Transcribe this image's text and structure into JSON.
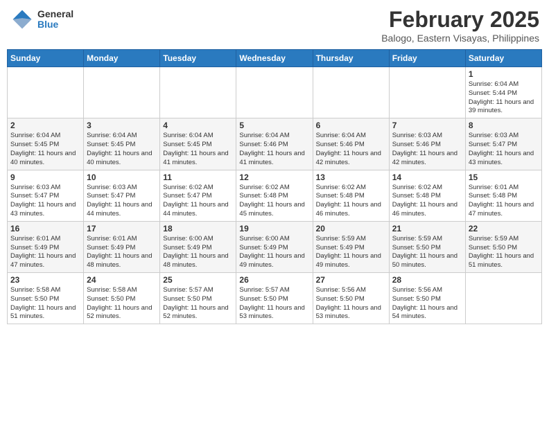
{
  "header": {
    "logo": {
      "line1": "General",
      "line2": "Blue"
    },
    "title": "February 2025",
    "location": "Balogo, Eastern Visayas, Philippines"
  },
  "weekdays": [
    "Sunday",
    "Monday",
    "Tuesday",
    "Wednesday",
    "Thursday",
    "Friday",
    "Saturday"
  ],
  "weeks": [
    [
      {
        "day": null,
        "info": null
      },
      {
        "day": null,
        "info": null
      },
      {
        "day": null,
        "info": null
      },
      {
        "day": null,
        "info": null
      },
      {
        "day": null,
        "info": null
      },
      {
        "day": null,
        "info": null
      },
      {
        "day": "1",
        "info": "Sunrise: 6:04 AM\nSunset: 5:44 PM\nDaylight: 11 hours and 39 minutes."
      }
    ],
    [
      {
        "day": "2",
        "info": "Sunrise: 6:04 AM\nSunset: 5:45 PM\nDaylight: 11 hours and 40 minutes."
      },
      {
        "day": "3",
        "info": "Sunrise: 6:04 AM\nSunset: 5:45 PM\nDaylight: 11 hours and 40 minutes."
      },
      {
        "day": "4",
        "info": "Sunrise: 6:04 AM\nSunset: 5:45 PM\nDaylight: 11 hours and 41 minutes."
      },
      {
        "day": "5",
        "info": "Sunrise: 6:04 AM\nSunset: 5:46 PM\nDaylight: 11 hours and 41 minutes."
      },
      {
        "day": "6",
        "info": "Sunrise: 6:04 AM\nSunset: 5:46 PM\nDaylight: 11 hours and 42 minutes."
      },
      {
        "day": "7",
        "info": "Sunrise: 6:03 AM\nSunset: 5:46 PM\nDaylight: 11 hours and 42 minutes."
      },
      {
        "day": "8",
        "info": "Sunrise: 6:03 AM\nSunset: 5:47 PM\nDaylight: 11 hours and 43 minutes."
      }
    ],
    [
      {
        "day": "9",
        "info": "Sunrise: 6:03 AM\nSunset: 5:47 PM\nDaylight: 11 hours and 43 minutes."
      },
      {
        "day": "10",
        "info": "Sunrise: 6:03 AM\nSunset: 5:47 PM\nDaylight: 11 hours and 44 minutes."
      },
      {
        "day": "11",
        "info": "Sunrise: 6:02 AM\nSunset: 5:47 PM\nDaylight: 11 hours and 44 minutes."
      },
      {
        "day": "12",
        "info": "Sunrise: 6:02 AM\nSunset: 5:48 PM\nDaylight: 11 hours and 45 minutes."
      },
      {
        "day": "13",
        "info": "Sunrise: 6:02 AM\nSunset: 5:48 PM\nDaylight: 11 hours and 46 minutes."
      },
      {
        "day": "14",
        "info": "Sunrise: 6:02 AM\nSunset: 5:48 PM\nDaylight: 11 hours and 46 minutes."
      },
      {
        "day": "15",
        "info": "Sunrise: 6:01 AM\nSunset: 5:48 PM\nDaylight: 11 hours and 47 minutes."
      }
    ],
    [
      {
        "day": "16",
        "info": "Sunrise: 6:01 AM\nSunset: 5:49 PM\nDaylight: 11 hours and 47 minutes."
      },
      {
        "day": "17",
        "info": "Sunrise: 6:01 AM\nSunset: 5:49 PM\nDaylight: 11 hours and 48 minutes."
      },
      {
        "day": "18",
        "info": "Sunrise: 6:00 AM\nSunset: 5:49 PM\nDaylight: 11 hours and 48 minutes."
      },
      {
        "day": "19",
        "info": "Sunrise: 6:00 AM\nSunset: 5:49 PM\nDaylight: 11 hours and 49 minutes."
      },
      {
        "day": "20",
        "info": "Sunrise: 5:59 AM\nSunset: 5:49 PM\nDaylight: 11 hours and 49 minutes."
      },
      {
        "day": "21",
        "info": "Sunrise: 5:59 AM\nSunset: 5:50 PM\nDaylight: 11 hours and 50 minutes."
      },
      {
        "day": "22",
        "info": "Sunrise: 5:59 AM\nSunset: 5:50 PM\nDaylight: 11 hours and 51 minutes."
      }
    ],
    [
      {
        "day": "23",
        "info": "Sunrise: 5:58 AM\nSunset: 5:50 PM\nDaylight: 11 hours and 51 minutes."
      },
      {
        "day": "24",
        "info": "Sunrise: 5:58 AM\nSunset: 5:50 PM\nDaylight: 11 hours and 52 minutes."
      },
      {
        "day": "25",
        "info": "Sunrise: 5:57 AM\nSunset: 5:50 PM\nDaylight: 11 hours and 52 minutes."
      },
      {
        "day": "26",
        "info": "Sunrise: 5:57 AM\nSunset: 5:50 PM\nDaylight: 11 hours and 53 minutes."
      },
      {
        "day": "27",
        "info": "Sunrise: 5:56 AM\nSunset: 5:50 PM\nDaylight: 11 hours and 53 minutes."
      },
      {
        "day": "28",
        "info": "Sunrise: 5:56 AM\nSunset: 5:50 PM\nDaylight: 11 hours and 54 minutes."
      },
      {
        "day": null,
        "info": null
      }
    ]
  ]
}
